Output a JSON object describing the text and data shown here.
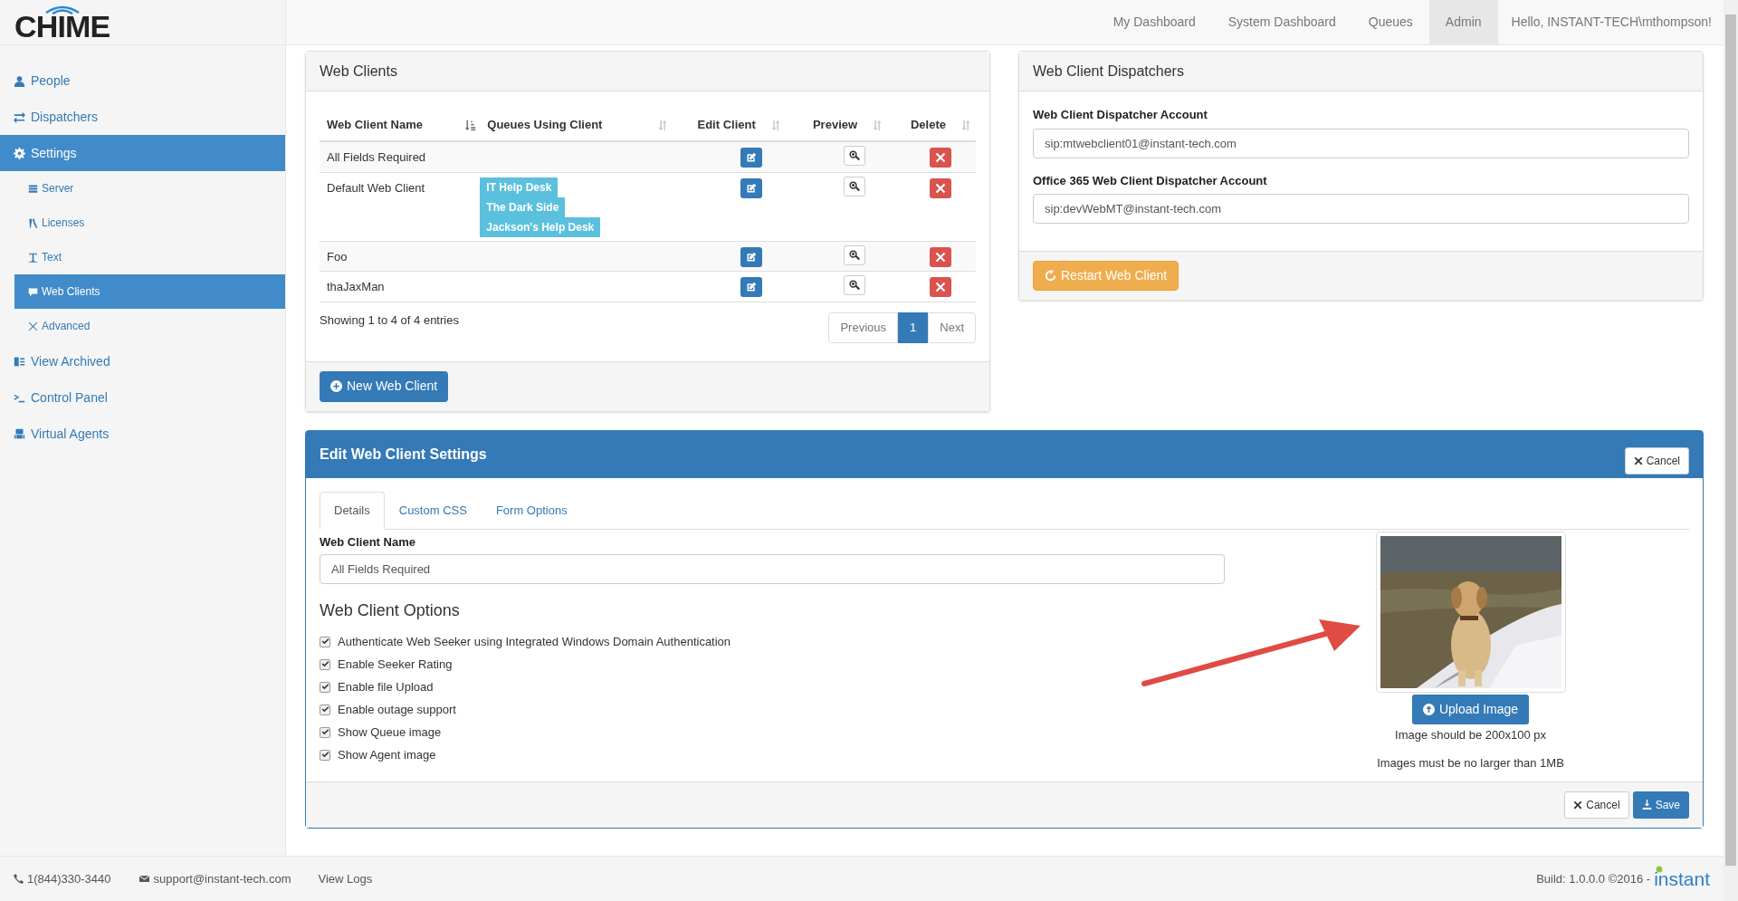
{
  "logo": "CHIME",
  "nav": {
    "items": [
      {
        "label": "My Dashboard",
        "selected": false
      },
      {
        "label": "System Dashboard",
        "selected": false
      },
      {
        "label": "Queues",
        "selected": false
      },
      {
        "label": "Admin",
        "selected": true
      }
    ],
    "greeting": "Hello, INSTANT-TECH\\mthompson!"
  },
  "sidebar": {
    "items": [
      {
        "label": "People",
        "selected": false
      },
      {
        "label": "Dispatchers",
        "selected": false
      },
      {
        "label": "Settings",
        "selected": true,
        "children": [
          {
            "label": "Server",
            "selected": false
          },
          {
            "label": "Licenses",
            "selected": false
          },
          {
            "label": "Text",
            "selected": false
          },
          {
            "label": "Web Clients",
            "selected": true
          },
          {
            "label": "Advanced",
            "selected": false
          }
        ]
      },
      {
        "label": "View Archived",
        "selected": false
      },
      {
        "label": "Control Panel",
        "selected": false
      },
      {
        "label": "Virtual Agents",
        "selected": false
      }
    ]
  },
  "web_clients": {
    "title": "Web Clients",
    "columns": [
      {
        "label": "Web Client Name",
        "sorted": true
      },
      {
        "label": "Queues Using Client",
        "sorted": false
      },
      {
        "label": "Edit Client",
        "sorted": false
      },
      {
        "label": "Preview",
        "sorted": false
      },
      {
        "label": "Delete",
        "sorted": false
      }
    ],
    "rows": [
      {
        "name": "All Fields Required",
        "queues": []
      },
      {
        "name": "Default Web Client",
        "queues": [
          "IT Help Desk",
          "The Dark Side",
          "Jackson's Help Desk"
        ]
      },
      {
        "name": "Foo",
        "queues": []
      },
      {
        "name": "thaJaxMan",
        "queues": []
      }
    ],
    "info": "Showing 1 to 4 of 4 entries",
    "pagination": {
      "previous": "Previous",
      "pages": [
        {
          "label": "1",
          "selected": true
        }
      ],
      "next": "Next"
    },
    "new_button": "New Web Client"
  },
  "dispatchers": {
    "title": "Web Client Dispatchers",
    "fields": [
      {
        "label": "Web Client Dispatcher Account",
        "value": "sip:mtwebclient01@instant-tech.com"
      },
      {
        "label": "Office 365 Web Client Dispatcher Account",
        "value": "sip:devWebMT@instant-tech.com"
      }
    ],
    "restart_button": "Restart Web Client"
  },
  "edit": {
    "title": "Edit Web Client Settings",
    "cancel": "Cancel",
    "tabs": [
      {
        "label": "Details",
        "selected": true
      },
      {
        "label": "Custom CSS",
        "selected": false
      },
      {
        "label": "Form Options",
        "selected": false
      }
    ],
    "name_label": "Web Client Name",
    "name_value": "All Fields Required",
    "options_title": "Web Client Options",
    "options": [
      {
        "label": "Authenticate Web Seeker using Integrated Windows Domain Authentication",
        "checked": true
      },
      {
        "label": "Enable Seeker Rating",
        "checked": true
      },
      {
        "label": "Enable file Upload",
        "checked": true
      },
      {
        "label": "Enable outage support",
        "checked": true
      },
      {
        "label": "Show Queue image",
        "checked": true
      },
      {
        "label": "Show Agent image",
        "checked": true
      }
    ],
    "image": {
      "kind": "picture"
    },
    "upload_button": "Upload Image",
    "notes": [
      "Image should be 200x100 px",
      "Images must be no larger than 1MB"
    ],
    "footer_cancel": "Cancel",
    "save": "Save"
  },
  "footer": {
    "phone": "1(844)330-3440",
    "email": "support@instant-tech.com",
    "logs": "View Logs",
    "build": "Build: 1.0.0.0 ©2016 -",
    "brand": "instant"
  }
}
